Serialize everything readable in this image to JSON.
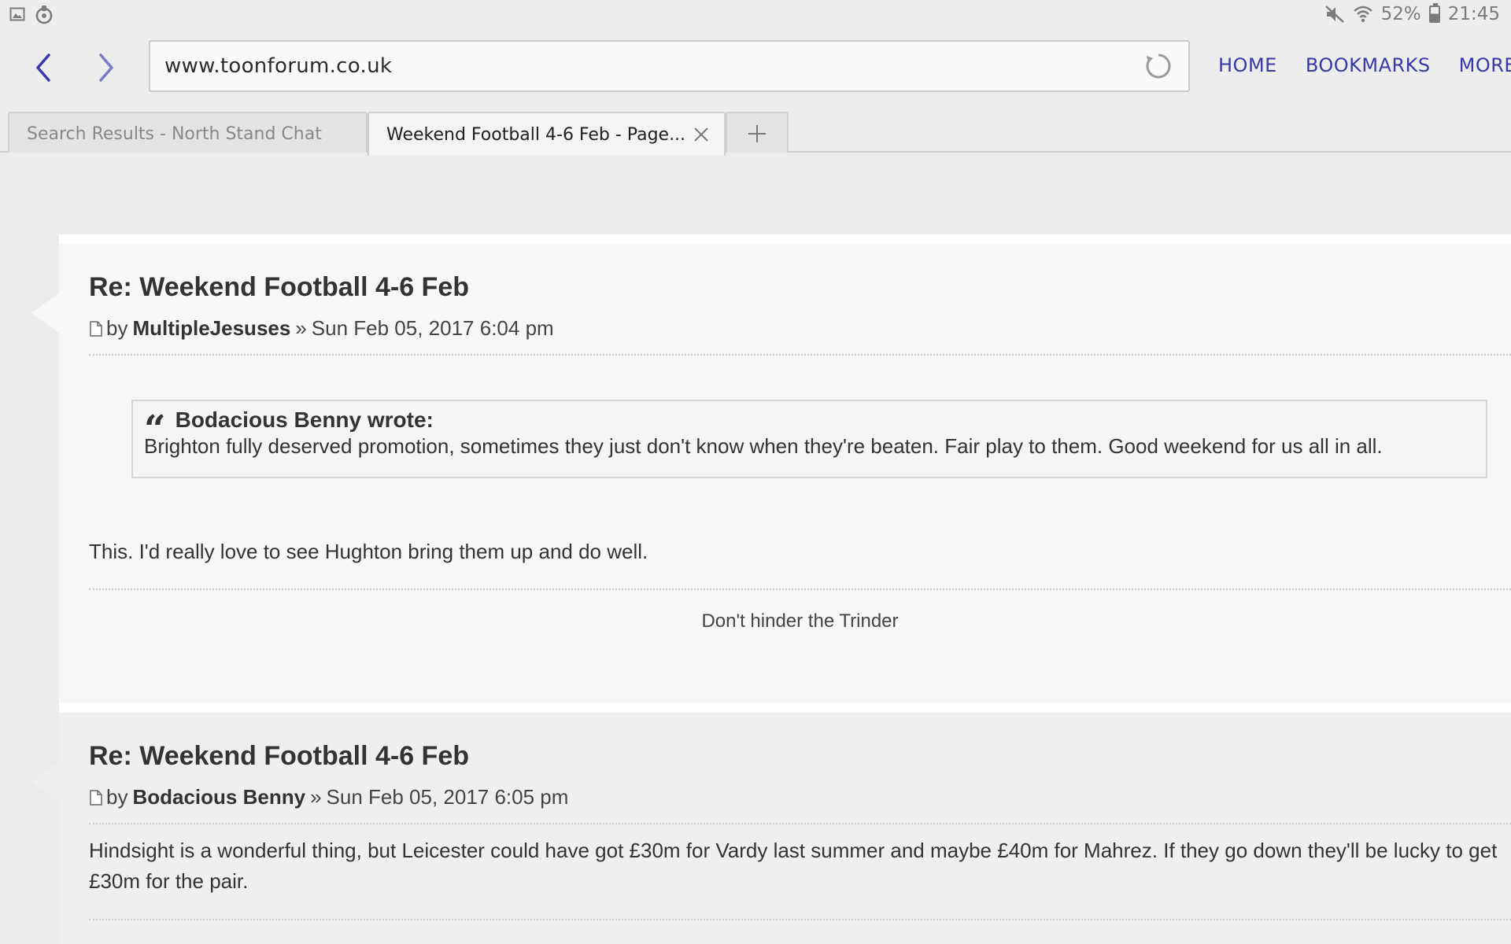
{
  "status_bar": {
    "battery": "52%",
    "time": "21:45",
    "icons": [
      "gallery-icon",
      "notification-icon",
      "mute-icon",
      "wifi-icon",
      "battery-icon"
    ]
  },
  "browser": {
    "url": "www.toonforum.co.uk",
    "links": {
      "home": "HOME",
      "bookmarks": "BOOKMARKS",
      "more": "MORE"
    },
    "tabs": [
      {
        "label": "Search Results - North Stand Chat",
        "active": false
      },
      {
        "label": "Weekend Football 4-6 Feb - Page...",
        "active": true
      }
    ],
    "accent_color": "#3838a8"
  },
  "posts": [
    {
      "title": "Re: Weekend Football 4-6 Feb",
      "by": "by",
      "author": "MultipleJesuses",
      "separator": "»",
      "date": "Sun Feb 05, 2017 6:04 pm",
      "quote": {
        "author_line": "Bodacious Benny wrote:",
        "text": "Brighton fully deserved promotion, sometimes they just don't know when they're beaten. Fair play to them. Good weekend for us all in all."
      },
      "body": "This. I'd really love to see Hughton bring them up and do well.",
      "signature": "Don't hinder the Trinder"
    },
    {
      "title": "Re: Weekend Football 4-6 Feb",
      "by": "by",
      "author": "Bodacious Benny",
      "separator": "»",
      "date": "Sun Feb 05, 2017 6:05 pm",
      "body": "Hindsight is a wonderful thing, but Leicester could have got £30m for Vardy last summer and maybe £40m for Mahrez. If they go down they'll be lucky to get £30m for the pair."
    }
  ]
}
